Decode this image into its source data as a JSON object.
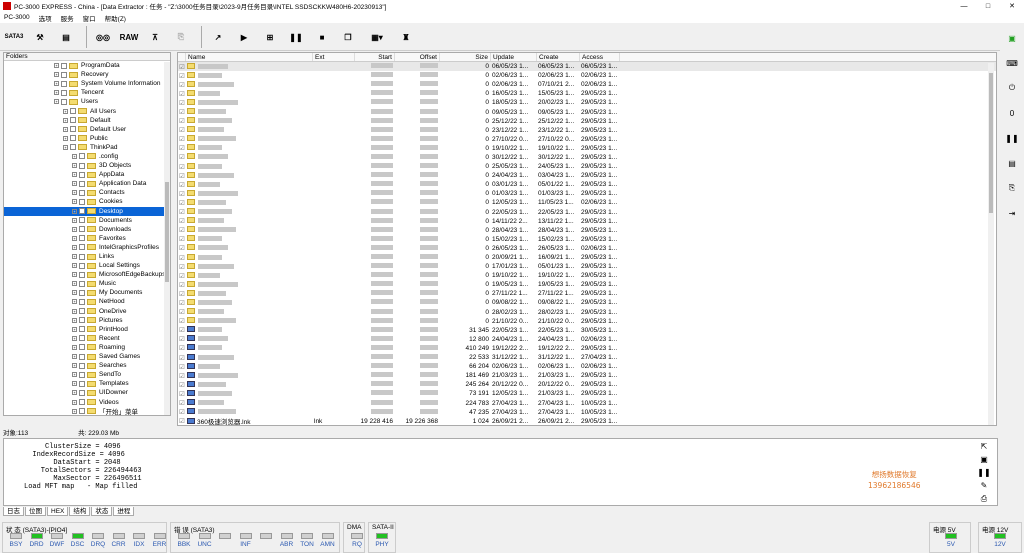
{
  "window": {
    "title": "PC-3000 EXPRESS - China - [Data Extractor : 任务 - \"Z:\\3000任务目录\\2023-9月任务目录\\INTEL SSDSCKKW480H6-20230913\"]",
    "min": "—",
    "max": "□",
    "close": "✕"
  },
  "menu": [
    "PC-3000",
    "选项",
    "服务",
    "窗口",
    "帮助(Z)"
  ],
  "toolbar": {
    "sata_label": "SATA3",
    "raw_label": "RAW"
  },
  "tree": {
    "header": "Folders",
    "items": [
      {
        "label": "ProgramData",
        "depth": 4
      },
      {
        "label": "Recovery",
        "depth": 4
      },
      {
        "label": "System Volume Information",
        "depth": 4
      },
      {
        "label": "Tencent",
        "depth": 4
      },
      {
        "label": "Users",
        "depth": 4
      },
      {
        "label": "All Users",
        "depth": 5
      },
      {
        "label": "Default",
        "depth": 5
      },
      {
        "label": "Default User",
        "depth": 5
      },
      {
        "label": "Public",
        "depth": 5
      },
      {
        "label": "ThinkPad",
        "depth": 5
      },
      {
        "label": ".config",
        "depth": 6
      },
      {
        "label": "3D Objects",
        "depth": 6
      },
      {
        "label": "AppData",
        "depth": 6
      },
      {
        "label": "Application Data",
        "depth": 6
      },
      {
        "label": "Contacts",
        "depth": 6
      },
      {
        "label": "Cookies",
        "depth": 6
      },
      {
        "label": "Desktop",
        "depth": 6,
        "selected": true
      },
      {
        "label": "Documents",
        "depth": 6
      },
      {
        "label": "Downloads",
        "depth": 6
      },
      {
        "label": "Favorites",
        "depth": 6
      },
      {
        "label": "IntelGraphicsProfiles",
        "depth": 6
      },
      {
        "label": "Links",
        "depth": 6
      },
      {
        "label": "Local Settings",
        "depth": 6
      },
      {
        "label": "MicrosoftEdgeBackups",
        "depth": 6
      },
      {
        "label": "Music",
        "depth": 6
      },
      {
        "label": "My Documents",
        "depth": 6
      },
      {
        "label": "NetHood",
        "depth": 6
      },
      {
        "label": "OneDrive",
        "depth": 6
      },
      {
        "label": "Pictures",
        "depth": 6
      },
      {
        "label": "PrintHood",
        "depth": 6
      },
      {
        "label": "Recent",
        "depth": 6
      },
      {
        "label": "Roaming",
        "depth": 6
      },
      {
        "label": "Saved Games",
        "depth": 6
      },
      {
        "label": "Searches",
        "depth": 6
      },
      {
        "label": "SendTo",
        "depth": 6
      },
      {
        "label": "Templates",
        "depth": 6
      },
      {
        "label": "UIDowner",
        "depth": 6
      },
      {
        "label": "Videos",
        "depth": 6
      },
      {
        "label": "「开始」菜单",
        "depth": 6
      }
    ]
  },
  "files": {
    "columns": [
      "Name",
      "Ext",
      "Start",
      "Offset",
      "Size",
      "Update",
      "Create",
      "Access"
    ],
    "rows": [
      {
        "size": "0",
        "update": "06/05/23 1...",
        "create": "06/05/23 1...",
        "access": "06/05/23 1..."
      },
      {
        "size": "0",
        "update": "02/06/23 1...",
        "create": "02/06/23 1...",
        "access": "02/06/23 1..."
      },
      {
        "size": "0",
        "update": "02/06/23 1...",
        "create": "07/10/21 2...",
        "access": "02/06/23 1..."
      },
      {
        "size": "0",
        "update": "16/05/23 1...",
        "create": "15/05/23 1...",
        "access": "29/05/23 1..."
      },
      {
        "size": "0",
        "update": "18/05/23 1...",
        "create": "20/02/23 1...",
        "access": "29/05/23 1..."
      },
      {
        "size": "0",
        "update": "09/05/23 1...",
        "create": "09/05/23 1...",
        "access": "29/05/23 1..."
      },
      {
        "size": "0",
        "update": "25/12/22 1...",
        "create": "25/12/22 1...",
        "access": "29/05/23 1..."
      },
      {
        "size": "0",
        "update": "23/12/22 1...",
        "create": "23/12/22 1...",
        "access": "29/05/23 1..."
      },
      {
        "size": "0",
        "update": "27/10/22 0...",
        "create": "27/10/22 0...",
        "access": "29/05/23 1..."
      },
      {
        "size": "0",
        "update": "19/10/22 1...",
        "create": "19/10/22 1...",
        "access": "29/05/23 1..."
      },
      {
        "size": "0",
        "update": "30/12/22 1...",
        "create": "30/12/22 1...",
        "access": "29/05/23 1..."
      },
      {
        "size": "0",
        "update": "25/05/23 1...",
        "create": "24/05/23 1...",
        "access": "29/05/23 1..."
      },
      {
        "size": "0",
        "update": "24/04/23 1...",
        "create": "03/04/23 1...",
        "access": "29/05/23 1..."
      },
      {
        "size": "0",
        "update": "03/01/23 1...",
        "create": "05/01/22 1...",
        "access": "29/05/23 1..."
      },
      {
        "size": "0",
        "update": "01/03/23 1...",
        "create": "01/03/23 1...",
        "access": "29/05/23 1..."
      },
      {
        "size": "0",
        "update": "12/05/23 1...",
        "create": "11/05/23 1...",
        "access": "02/06/23 1..."
      },
      {
        "size": "0",
        "update": "22/05/23 1...",
        "create": "22/05/23 1...",
        "access": "29/05/23 1..."
      },
      {
        "size": "0",
        "update": "14/11/22 2...",
        "create": "13/11/22 1...",
        "access": "29/05/23 1..."
      },
      {
        "size": "0",
        "update": "28/04/23 1...",
        "create": "28/04/23 1...",
        "access": "29/05/23 1..."
      },
      {
        "size": "0",
        "update": "15/02/23 1...",
        "create": "15/02/23 1...",
        "access": "29/05/23 1..."
      },
      {
        "size": "0",
        "update": "26/05/23 1...",
        "create": "26/05/23 1...",
        "access": "02/06/23 1..."
      },
      {
        "size": "0",
        "update": "20/09/21 1...",
        "create": "16/09/21 1...",
        "access": "29/05/23 1..."
      },
      {
        "size": "0",
        "update": "17/01/23 1...",
        "create": "05/01/23 1...",
        "access": "29/05/23 1..."
      },
      {
        "size": "0",
        "update": "19/10/22 1...",
        "create": "19/10/22 1...",
        "access": "29/05/23 1..."
      },
      {
        "size": "0",
        "update": "19/05/23 1...",
        "create": "19/05/23 1...",
        "access": "29/05/23 1..."
      },
      {
        "size": "0",
        "update": "27/11/22 1...",
        "create": "27/11/22 1...",
        "access": "29/05/23 1..."
      },
      {
        "size": "0",
        "update": "09/08/22 1...",
        "create": "09/08/22 1...",
        "access": "29/05/23 1..."
      },
      {
        "size": "0",
        "update": "28/02/23 1...",
        "create": "28/02/23 1...",
        "access": "29/05/23 1..."
      },
      {
        "size": "0",
        "update": "21/10/22 0...",
        "create": "21/10/22 0...",
        "access": "29/05/23 1..."
      },
      {
        "size": "31 345",
        "update": "22/05/23 1...",
        "create": "22/05/23 1...",
        "access": "30/05/23 1...",
        "doc": true
      },
      {
        "size": "12 800",
        "update": "24/04/23 1...",
        "create": "24/04/23 1...",
        "access": "02/06/23 1...",
        "doc": true
      },
      {
        "size": "410 249",
        "update": "19/12/22 2...",
        "create": "19/12/22 2...",
        "access": "29/05/23 1...",
        "doc": true
      },
      {
        "size": "22 533",
        "update": "31/12/22 1...",
        "create": "31/12/22 1...",
        "access": "27/04/23 1...",
        "doc": true
      },
      {
        "size": "66 204",
        "update": "02/06/23 1...",
        "create": "02/06/23 1...",
        "access": "02/06/23 1...",
        "doc": true
      },
      {
        "size": "181 469",
        "update": "21/03/23 1...",
        "create": "21/03/23 1...",
        "access": "29/05/23 1...",
        "doc": true
      },
      {
        "size": "245 264",
        "update": "20/12/22 0...",
        "create": "20/12/22 0...",
        "access": "29/05/23 1...",
        "doc": true
      },
      {
        "size": "73 191",
        "update": "12/05/23 1...",
        "create": "21/03/23 1...",
        "access": "29/05/23 1...",
        "doc": true
      },
      {
        "size": "224 783",
        "update": "27/04/23 1...",
        "create": "27/04/23 1...",
        "access": "10/05/23 1...",
        "doc": true
      },
      {
        "size": "47 235",
        "update": "27/04/23 1...",
        "create": "27/04/23 1...",
        "access": "10/05/23 1...",
        "doc": true
      },
      {
        "name": "360极速浏览器.lnk",
        "ext": "lnk",
        "start": "19 228 416",
        "offset": "19 226 368",
        "size": "1 024",
        "update": "26/09/21 2...",
        "create": "26/09/21 2...",
        "access": "29/05/23 1...",
        "doc": true
      }
    ]
  },
  "status": {
    "objects": "对象:113",
    "total": "共: 229.03 Mb"
  },
  "log": [
    "     ClusterSize = 4096",
    "  IndexRecordSize = 4096",
    "       DataStart = 2048",
    "    TotalSectors = 226494463",
    "       MaxSector = 226496511",
    "Load MFT map   - Map filled"
  ],
  "promo": {
    "line1": "想扬数据恢复",
    "line2": "13962186546"
  },
  "log_tabs": [
    "日志",
    "位图",
    "HEX",
    "结构",
    "状态",
    "进程"
  ],
  "leds": {
    "status_group": {
      "title": "状 态 (SATA3)-[PIO4]",
      "items": [
        {
          "t": "BSY",
          "on": false
        },
        {
          "t": "DRD",
          "on": true
        },
        {
          "t": "DWF",
          "on": false
        },
        {
          "t": "DSC",
          "on": true
        },
        {
          "t": "DRQ",
          "on": false
        },
        {
          "t": "CRR",
          "on": false
        },
        {
          "t": "IDX",
          "on": false
        },
        {
          "t": "ERR",
          "on": false
        }
      ]
    },
    "error_group": {
      "title": "错 误 (SATA3)",
      "items": [
        {
          "t": "BBK",
          "on": false
        },
        {
          "t": "UNC",
          "on": false
        },
        {
          "t": "",
          "on": false
        },
        {
          "t": "INF",
          "on": false
        },
        {
          "t": "",
          "on": false
        },
        {
          "t": "ABR",
          "on": false
        },
        {
          "t": "TON",
          "on": false
        },
        {
          "t": "AMN",
          "on": false
        }
      ]
    },
    "dma": {
      "title": "DMA",
      "items": [
        {
          "t": "RQ",
          "on": false
        }
      ]
    },
    "sata": {
      "title": "SATA-II",
      "items": [
        {
          "t": "PHY",
          "on": true
        }
      ]
    },
    "p5": {
      "title": "电源 5V",
      "items": [
        {
          "t": "5V",
          "on": true
        }
      ]
    },
    "p12": {
      "title": "电源 12V",
      "items": [
        {
          "t": "12V",
          "on": true
        }
      ]
    }
  }
}
